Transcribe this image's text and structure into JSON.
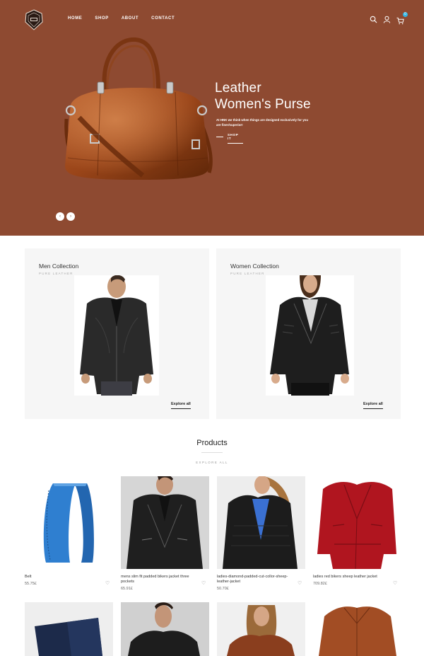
{
  "header": {
    "nav": [
      "HOME",
      "SHOP",
      "ABOUT",
      "CONTACT"
    ],
    "cart_count": "0"
  },
  "hero": {
    "title_line1": "Leather",
    "title_line2": "Women's Purse",
    "description": "At HNK we think when things are designed exclusively for you are finer/superior!",
    "cta": "SHOP IT",
    "prev": "‹",
    "next": "›"
  },
  "collections": [
    {
      "title": "Men Collection",
      "subtitle": "PURE LEATHER",
      "link": "Explore all"
    },
    {
      "title": "Women Collection",
      "subtitle": "PURE LEATHER",
      "link": "Explore all"
    }
  ],
  "products": {
    "heading": "Products",
    "explore": "EXPLORE ALL",
    "items": [
      {
        "name": "Belt",
        "price": "55.75£"
      },
      {
        "name": "mens slim fit padded bikers jacket three pockets",
        "price": "65.91£"
      },
      {
        "name": "ladies-diamond-padded-cut-collor-sheep-leather-jacket",
        "price": "50.70£"
      },
      {
        "name": "ladies red bikers sheep leather jacket",
        "price": "709.82£"
      }
    ]
  },
  "colors": {
    "hero_bg": "#8e4a31",
    "badge": "#33b6e6",
    "panel_bg": "#f6f6f6"
  }
}
